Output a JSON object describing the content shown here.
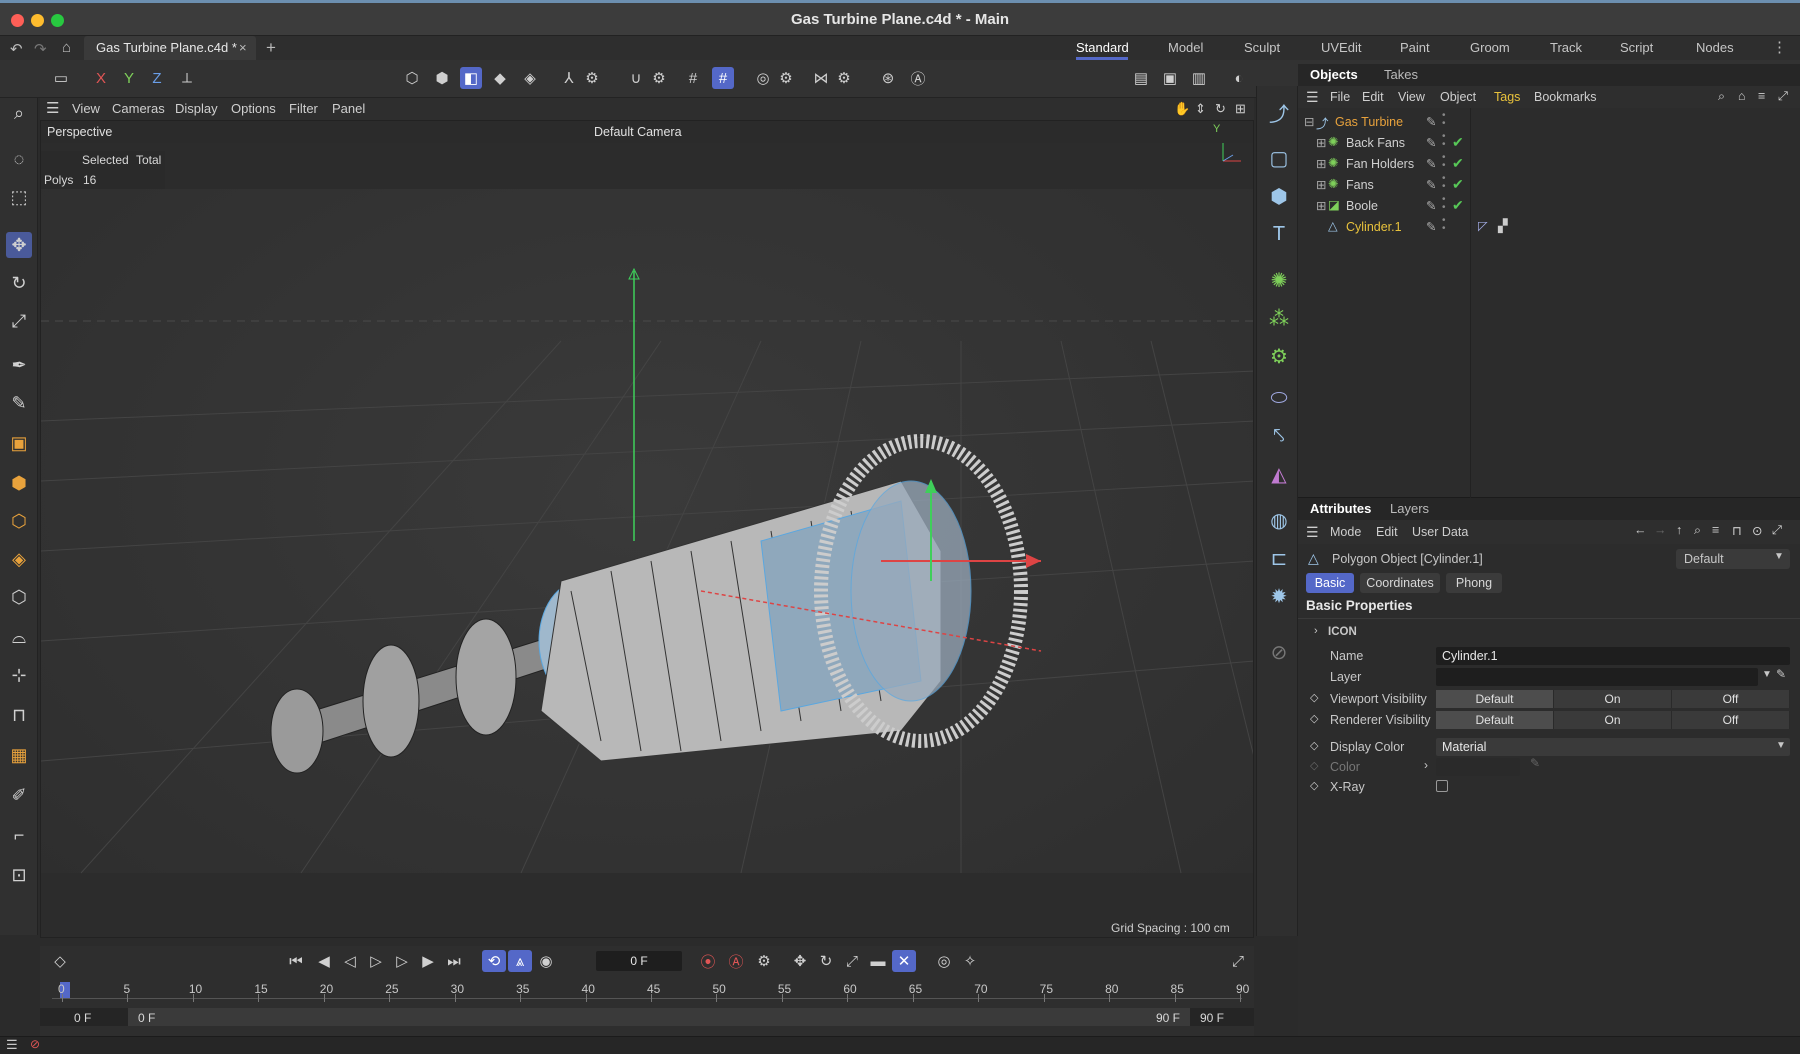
{
  "window": {
    "title": "Gas Turbine Plane.c4d * - Main"
  },
  "tabbar": {
    "doc_tab": "Gas Turbine Plane.c4d *",
    "layouts": [
      "Standard",
      "Model",
      "Sculpt",
      "UVEdit",
      "Paint",
      "Groom",
      "Track",
      "Script",
      "Nodes"
    ],
    "active_layout": "Standard"
  },
  "toolbar": {
    "axes": [
      "X",
      "Y",
      "Z"
    ]
  },
  "viewport": {
    "menu": [
      "View",
      "Cameras",
      "Display",
      "Options",
      "Filter",
      "Panel"
    ],
    "projection": "Perspective",
    "camera": "Default Camera",
    "stats_selected": "Selected",
    "stats_total": "Total",
    "stats_polys_label": "Polys",
    "stats_polys_value": "16",
    "grid_spacing": "Grid Spacing : 100 cm",
    "axis_y": "Y"
  },
  "objects_panel": {
    "tabs": [
      "Objects",
      "Takes"
    ],
    "menu": [
      "File",
      "Edit",
      "View",
      "Object",
      "Tags",
      "Bookmarks"
    ],
    "items": [
      {
        "name": "Gas Turbine",
        "color": "#e8a23c"
      },
      {
        "name": "Back Fans",
        "color": "#d0d0d0"
      },
      {
        "name": "Fan Holders",
        "color": "#d0d0d0"
      },
      {
        "name": "Fans",
        "color": "#d0d0d0"
      },
      {
        "name": "Boole",
        "color": "#d0d0d0"
      },
      {
        "name": "Cylinder.1",
        "color": "#e8c23c"
      }
    ]
  },
  "attributes_panel": {
    "tabs": [
      "Attributes",
      "Layers"
    ],
    "menu": [
      "Mode",
      "Edit",
      "User Data"
    ],
    "object_title": "Polygon Object [Cylinder.1]",
    "preset": "Default",
    "subtabs": [
      "Basic",
      "Coordinates",
      "Phong"
    ],
    "active_subtab": "Basic",
    "section": "Basic Properties",
    "group": "ICON",
    "name_label": "Name",
    "name_value": "Cylinder.1",
    "layer_label": "Layer",
    "viewport_visibility_label": "Viewport Visibility",
    "renderer_visibility_label": "Renderer Visibility",
    "vis_options": [
      "Default",
      "On",
      "Off"
    ],
    "display_color_label": "Display Color",
    "display_color_value": "Material",
    "color_label": "Color",
    "xray_label": "X-Ray"
  },
  "timeline": {
    "current_frame": "0 F",
    "ticks": [
      "0",
      "5",
      "10",
      "15",
      "20",
      "25",
      "30",
      "35",
      "40",
      "45",
      "50",
      "55",
      "60",
      "65",
      "70",
      "75",
      "80",
      "85",
      "90"
    ],
    "start_a": "0 F",
    "start_b": "0 F",
    "end_a": "90 F",
    "end_b": "90 F"
  },
  "colors": {
    "accent": "#5468c8",
    "selection": "#6fb4e6",
    "checkmark": "#57c857"
  }
}
